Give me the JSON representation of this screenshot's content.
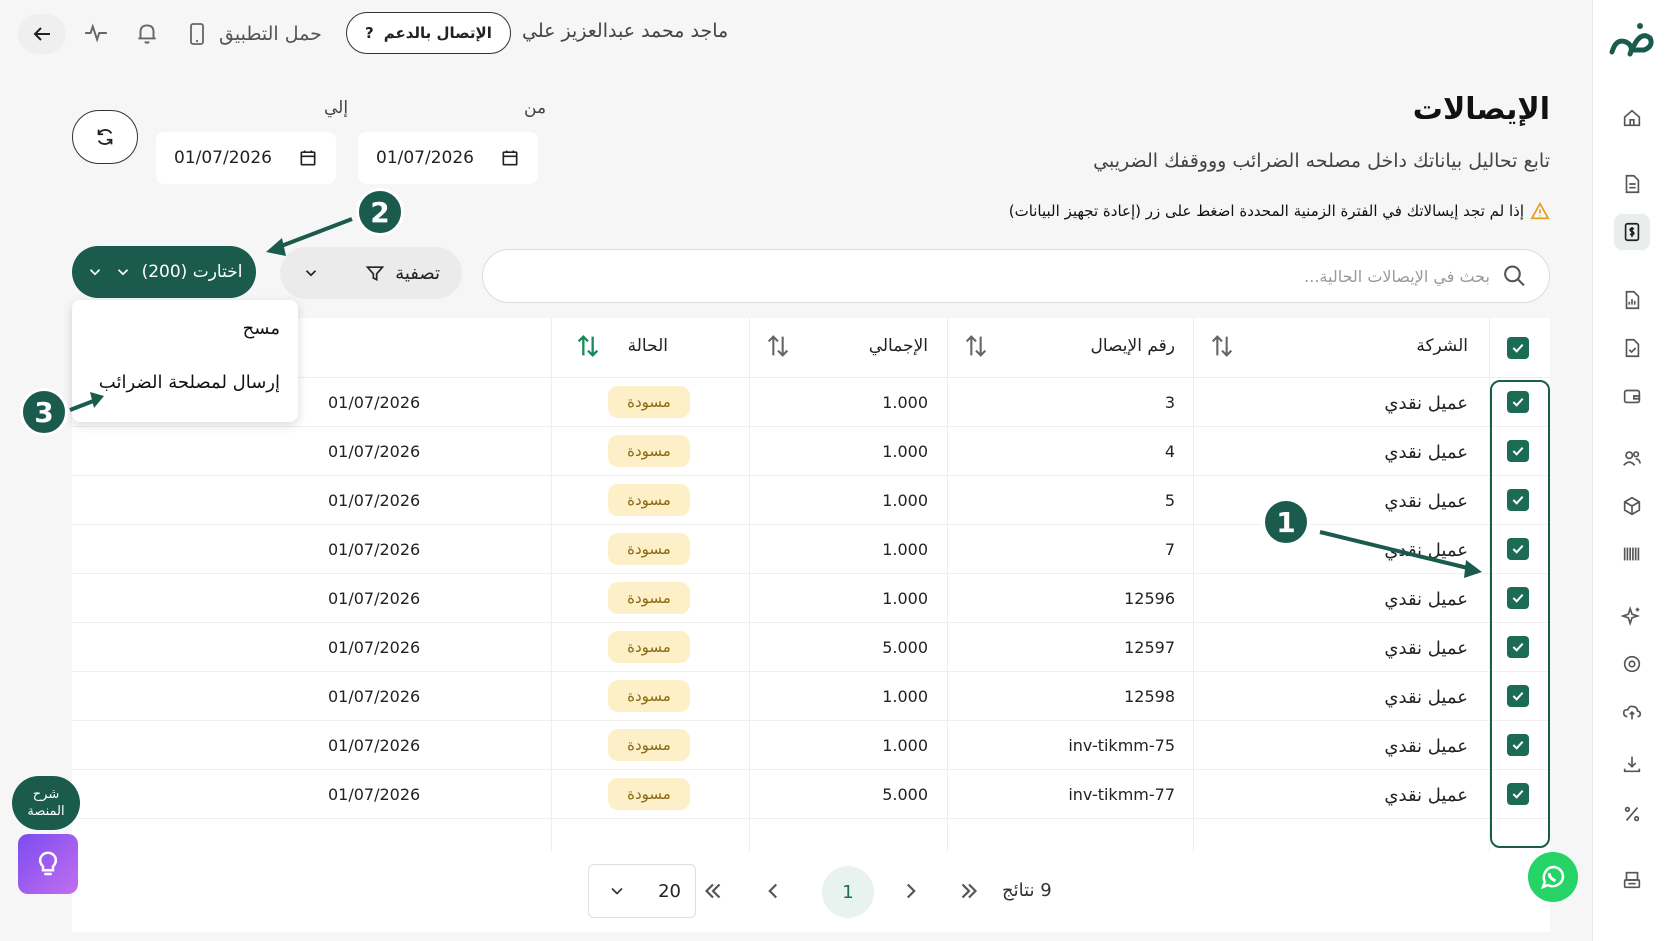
{
  "header": {
    "username": "ماجد محمد عبدالعزيز علي",
    "support_label": "الإتصال بالدعم",
    "support_icon": "?",
    "download_app": "حمل التطبيق"
  },
  "page": {
    "title": "الإيصالات",
    "subtitle": "تابع تحاليل بياناتك داخل مصلحه الضرائب وووقفك الضريبي",
    "warning": "إذا لم تجد إيسالاتك في الفترة الزمنية المحددة اضغط على زر (إعادة تجهيز البيانات)"
  },
  "filters": {
    "from_label": "من",
    "to_label": "إلي",
    "from_value": "01/07/2026",
    "to_value": "01/07/2026",
    "search_placeholder": "بحث في الإيصالات الحالية...",
    "filter_label": "تصفية",
    "select_label": "اختارت (200)"
  },
  "dropdown": {
    "items": [
      "مسح",
      "إرسال لمصلحة الضرائب"
    ]
  },
  "table": {
    "columns": {
      "company": "الشركة",
      "receipt_number": "رقم الإيصال",
      "total": "الإجمالي",
      "status": "الحالة"
    },
    "rows": [
      {
        "company": "عميل نقدي",
        "number": "3",
        "total": "1.000",
        "status": "مسودة",
        "date": "01/07/2026"
      },
      {
        "company": "عميل نقدي",
        "number": "4",
        "total": "1.000",
        "status": "مسودة",
        "date": "01/07/2026"
      },
      {
        "company": "عميل نقدي",
        "number": "5",
        "total": "1.000",
        "status": "مسودة",
        "date": "01/07/2026"
      },
      {
        "company": "عميل نقدي",
        "number": "7",
        "total": "1.000",
        "status": "مسودة",
        "date": "01/07/2026"
      },
      {
        "company": "عميل نقدي",
        "number": "12596",
        "total": "1.000",
        "status": "مسودة",
        "date": "01/07/2026"
      },
      {
        "company": "عميل نقدي",
        "number": "12597",
        "total": "5.000",
        "status": "مسودة",
        "date": "01/07/2026"
      },
      {
        "company": "عميل نقدي",
        "number": "12598",
        "total": "1.000",
        "status": "مسودة",
        "date": "01/07/2026"
      },
      {
        "company": "عميل نقدي",
        "number": "inv-tikmm-75",
        "total": "1.000",
        "status": "مسودة",
        "date": "01/07/2026"
      },
      {
        "company": "عميل نقدي",
        "number": "inv-tikmm-77",
        "total": "5.000",
        "status": "مسودة",
        "date": "01/07/2026"
      }
    ]
  },
  "pagination": {
    "page_size": "20",
    "current_page": "1",
    "results": "9 نتائج"
  },
  "annotations": [
    "1",
    "2",
    "3"
  ],
  "help": {
    "line1": "شرح",
    "line2": "المنصة"
  },
  "colors": {
    "brand": "#1b5b4d",
    "checkbox": "#1b6b55",
    "badge_bg": "#fdf0c8",
    "badge_text": "#8a6a10",
    "whatsapp": "#25d366"
  },
  "icons": [
    "back-arrow-icon",
    "activity-icon",
    "bell-icon",
    "phone-icon",
    "help-icon",
    "refresh-icon",
    "calendar-icon",
    "search-icon",
    "filter-icon",
    "chevron-down-icon",
    "sort-icon",
    "check-icon",
    "warning-icon",
    "whatsapp-icon",
    "bulb-icon",
    "home-icon",
    "document-icon",
    "dollar-icon",
    "report-icon",
    "file-check-icon",
    "wallet-icon",
    "users-icon",
    "box-icon",
    "barcode-icon",
    "sparkle-icon",
    "settings-icon",
    "cloud-upload-icon",
    "download-icon",
    "percent-icon",
    "printer-icon"
  ]
}
